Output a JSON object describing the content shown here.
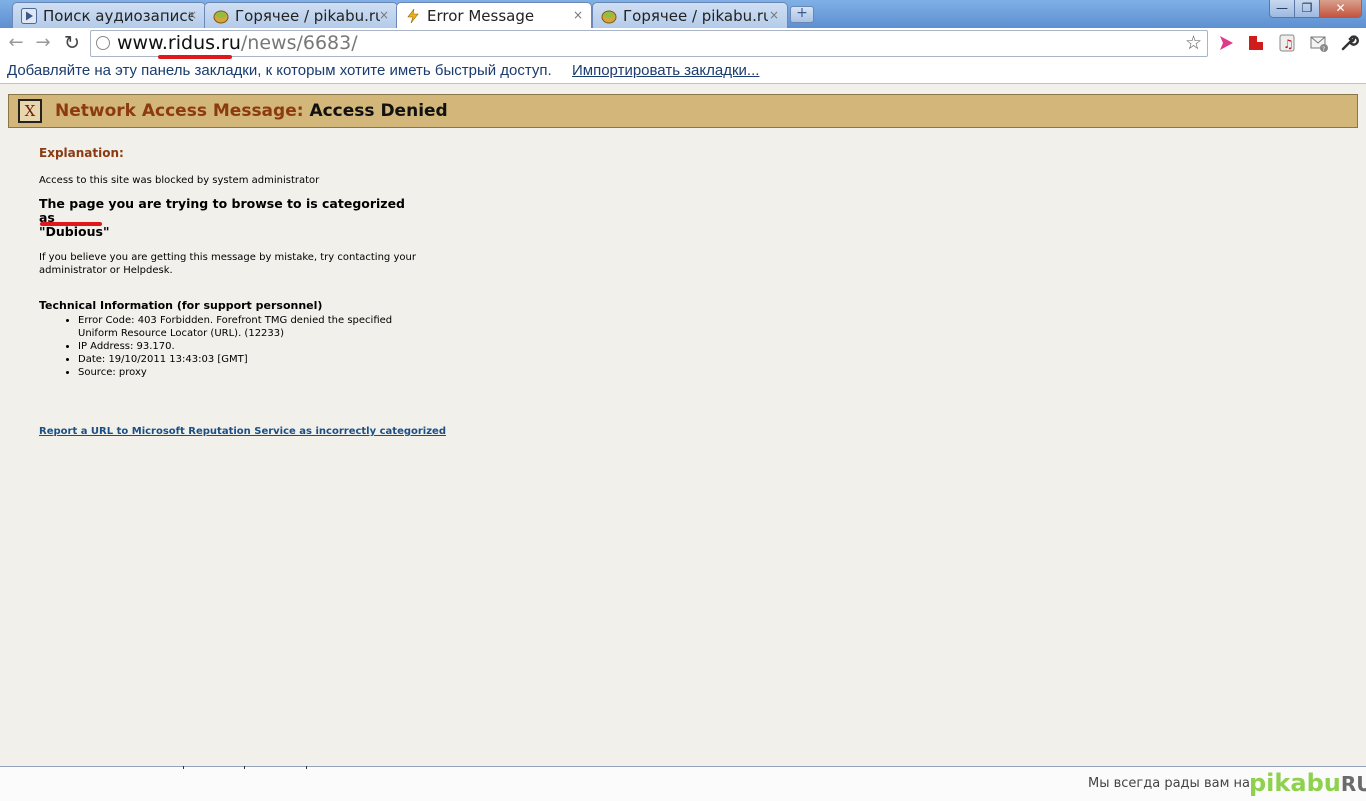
{
  "tabs": [
    {
      "title": "Поиск аудиозаписей",
      "favicon": "play-icon"
    },
    {
      "title": "Горячее / pikabu.ru",
      "favicon": "pikabu-icon"
    },
    {
      "title": "Error Message",
      "favicon": "warning-icon"
    },
    {
      "title": "Горячее / pikabu.ru",
      "favicon": "pikabu-icon"
    }
  ],
  "tab_close": "×",
  "new_tab": "+",
  "window_controls": {
    "minimize": "—",
    "maximize": "❐",
    "close": "✕"
  },
  "omnibox": {
    "domain": "www.ridus.ru",
    "path": "/news/6683/"
  },
  "bookmarks": {
    "prompt": "Добавляйте на эту панель закладки, к которым хотите иметь быстрый доступ.",
    "import_link": "Импортировать закладки..."
  },
  "error_page": {
    "close_symbol": "X",
    "banner_label": "Network Access Message:",
    "banner_value": "Access Denied",
    "explanation_heading": "Explanation:",
    "blocked_text": "Access to this site was blocked by system administrator",
    "category_text": "The page you are trying to browse to is categorized as",
    "category_value": "\"Dubious\"",
    "mistake_text": "If you believe you are getting this message by mistake, try contacting your administrator or Helpdesk.",
    "tech_heading": "Technical Information (for support personnel)",
    "tech_items": [
      "Error Code: 403 Forbidden. Forefront TMG denied the specified Uniform Resource Locator (URL). (12233)",
      "IP Address: 93.170.",
      "Date: 19/10/2011 13:43:03 [GMT]",
      "Source: proxy"
    ],
    "report_link": "Report a URL to Microsoft Reputation Service as incorrectly categorized"
  },
  "watermark": {
    "text": "Мы всегда рады вам на",
    "logo": "pikabu",
    "logo_suffix": "RU"
  },
  "colors": {
    "banner": "#d3b77a",
    "heading": "#8b3a12",
    "link": "#1a4f86",
    "highlight": "#e0181b"
  }
}
